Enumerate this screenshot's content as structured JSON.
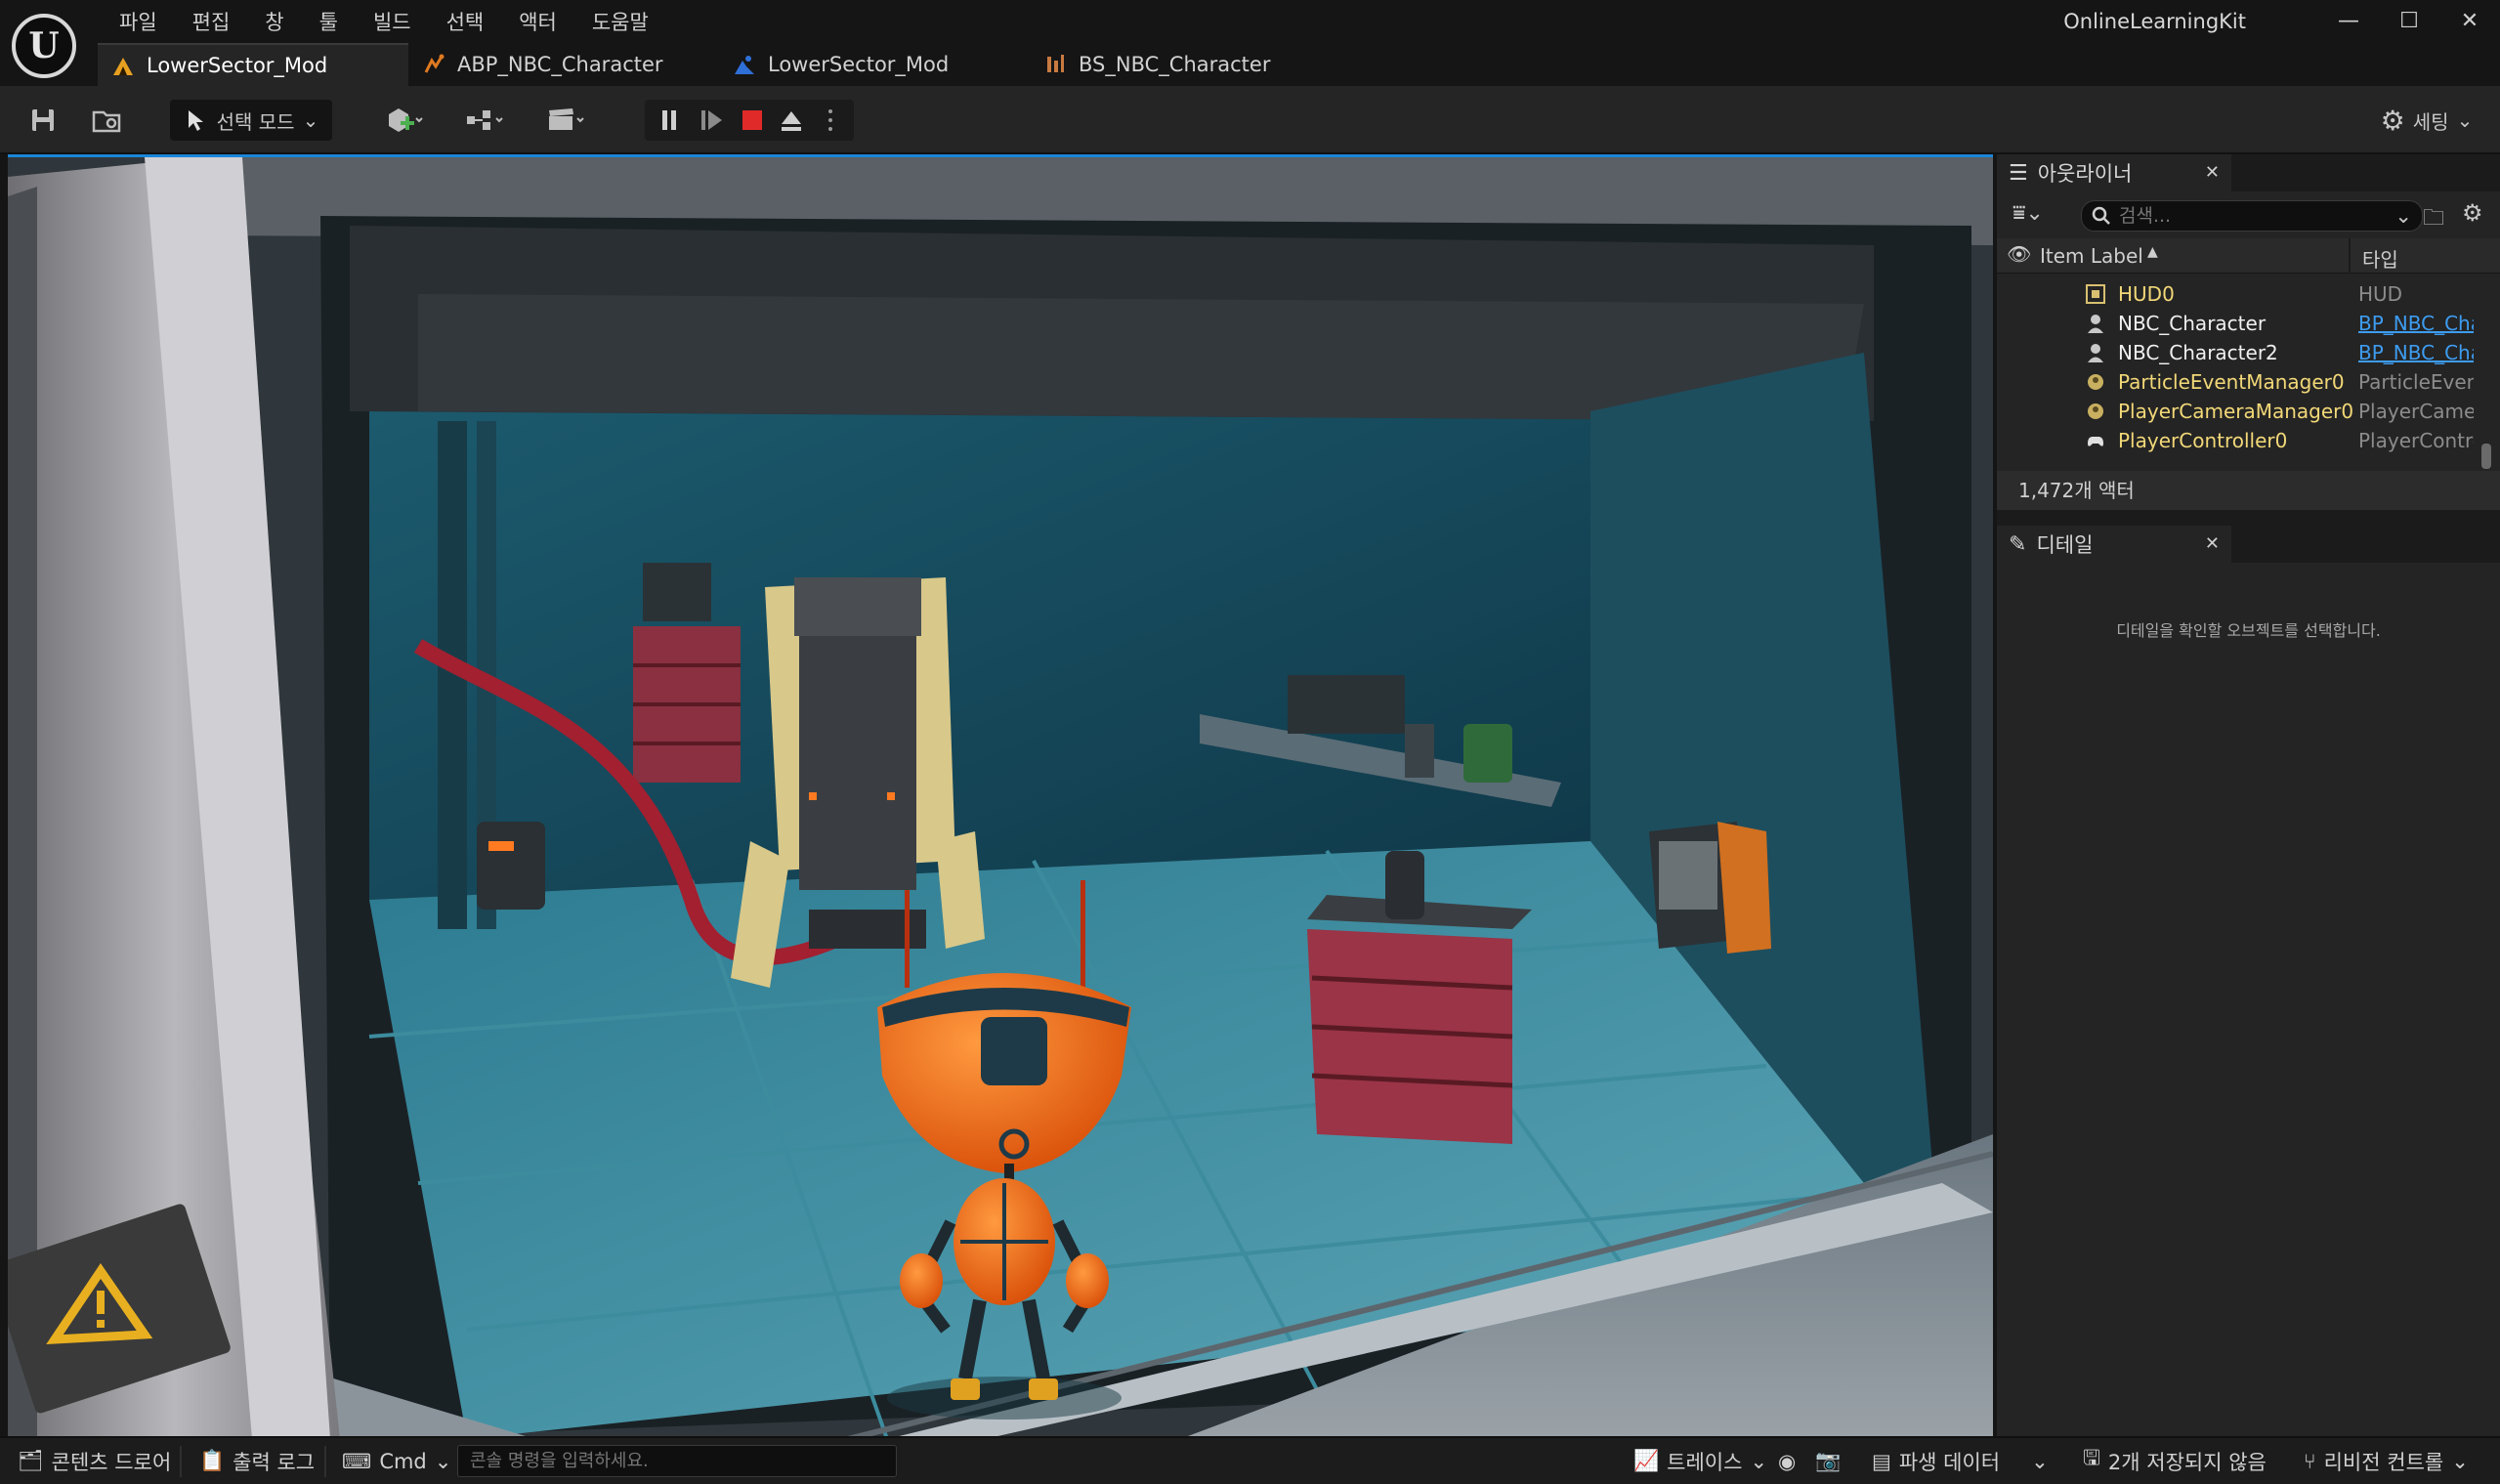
{
  "app": {
    "project_name": "OnlineLearningKit",
    "menu": [
      "파일",
      "편집",
      "창",
      "툴",
      "빌드",
      "선택",
      "액터",
      "도움말"
    ],
    "window_controls": {
      "minimize": "—",
      "maximize": "☐",
      "close": "✕"
    }
  },
  "tabs": [
    {
      "label": "LowerSector_Mod",
      "icon": "level-icon",
      "active": true
    },
    {
      "label": "ABP_NBC_Character",
      "icon": "anim-blueprint-icon",
      "active": false
    },
    {
      "label": "LowerSector_Mod",
      "icon": "level-sequence-icon",
      "active": false
    },
    {
      "label": "BS_NBC_Character",
      "icon": "blendspace-icon",
      "active": false
    }
  ],
  "toolbar": {
    "mode_label": "선택 모드",
    "settings_label": "세팅"
  },
  "outliner": {
    "title": "아웃라이너",
    "search_placeholder": "검색...",
    "col_label": "Item Label",
    "col_type": "타입",
    "rows": [
      {
        "label": "HUD0",
        "type": "HUD",
        "icon": "hud-icon",
        "type_link": false
      },
      {
        "label": "NBC_Character",
        "type": "BP_NBC_Cha",
        "icon": "pawn-icon",
        "type_link": true
      },
      {
        "label": "NBC_Character2",
        "type": "BP_NBC_Cha",
        "icon": "pawn-icon",
        "type_link": true
      },
      {
        "label": "ParticleEventManager0",
        "type": "ParticleEvent",
        "icon": "actor-icon",
        "type_link": false
      },
      {
        "label": "PlayerCameraManager0",
        "type": "PlayerCamera",
        "icon": "actor-icon",
        "type_link": false
      },
      {
        "label": "PlayerController0",
        "type": "PlayerContro",
        "icon": "gamepad-icon",
        "type_link": false
      }
    ],
    "actor_count": "1,472개 액터"
  },
  "details": {
    "title": "디테일",
    "empty_message": "디테일을 확인할 오브젝트를 선택합니다."
  },
  "statusbar": {
    "content_drawer": "콘텐츠 드로어",
    "output_log": "출력 로그",
    "cmd": "Cmd",
    "console_placeholder": "콘솔 명령을 입력하세요.",
    "trace": "트레이스",
    "derived_data": "파생 데이터",
    "unsaved": "2개 저장되지 않음",
    "revision_control": "리비전 컨트롤"
  },
  "colors": {
    "accent_blue": "#1a86d8",
    "link_blue": "#3d9cf0",
    "stop_red": "#e02a2a",
    "warning_yellow": "#e8b020",
    "robot_orange": "#f06a10"
  }
}
